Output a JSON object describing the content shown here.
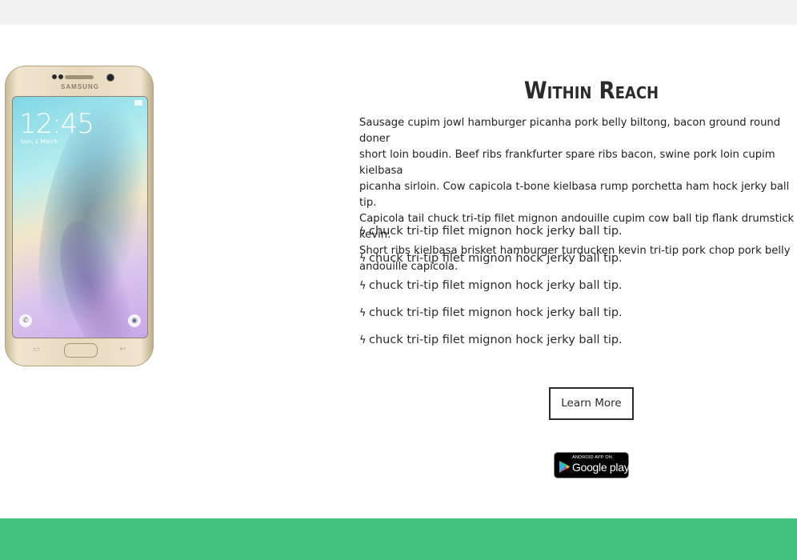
{
  "colors": {
    "top_band": "#f2f2f2",
    "bottom_band": "#42c17f",
    "text": "#2b2b2b",
    "button_border": "#2b2b2b"
  },
  "phone": {
    "brand": "SAMSUNG",
    "clock": "12:45",
    "date": "Sun, 1 March"
  },
  "section": {
    "heading": "Within Reach",
    "paragraph": "Sausage cupim jowl hamburger picanha pork belly biltong, bacon ground round doner\nshort loin boudin. Beef ribs frankfurter spare ribs bacon, swine pork loin cupim kielbasa\npicanha sirloin. Cow capicola t-bone kielbasa rump porchetta ham hock jerky ball tip.\nCapicola tail chuck tri-tip filet mignon andouille cupim cow ball tip flank drumstick kevin.\nShort ribs kielbasa brisket hamburger turducken kevin tri-tip pork chop pork belly\nandouille capicola.",
    "bullet_icon": "lightning-bolt-icon",
    "bullets": [
      "chuck tri-tip filet mignon hock jerky ball tip.",
      "chuck tri-tip filet mignon hock jerky ball tip.",
      "chuck tri-tip filet mignon hock jerky ball tip.",
      "chuck tri-tip filet mignon hock jerky ball tip.",
      "chuck tri-tip filet mignon hock jerky ball tip."
    ],
    "button_label": "Learn More",
    "badge": {
      "top_text": "ANDROID APP ON",
      "bottom_text": "Google play"
    }
  }
}
